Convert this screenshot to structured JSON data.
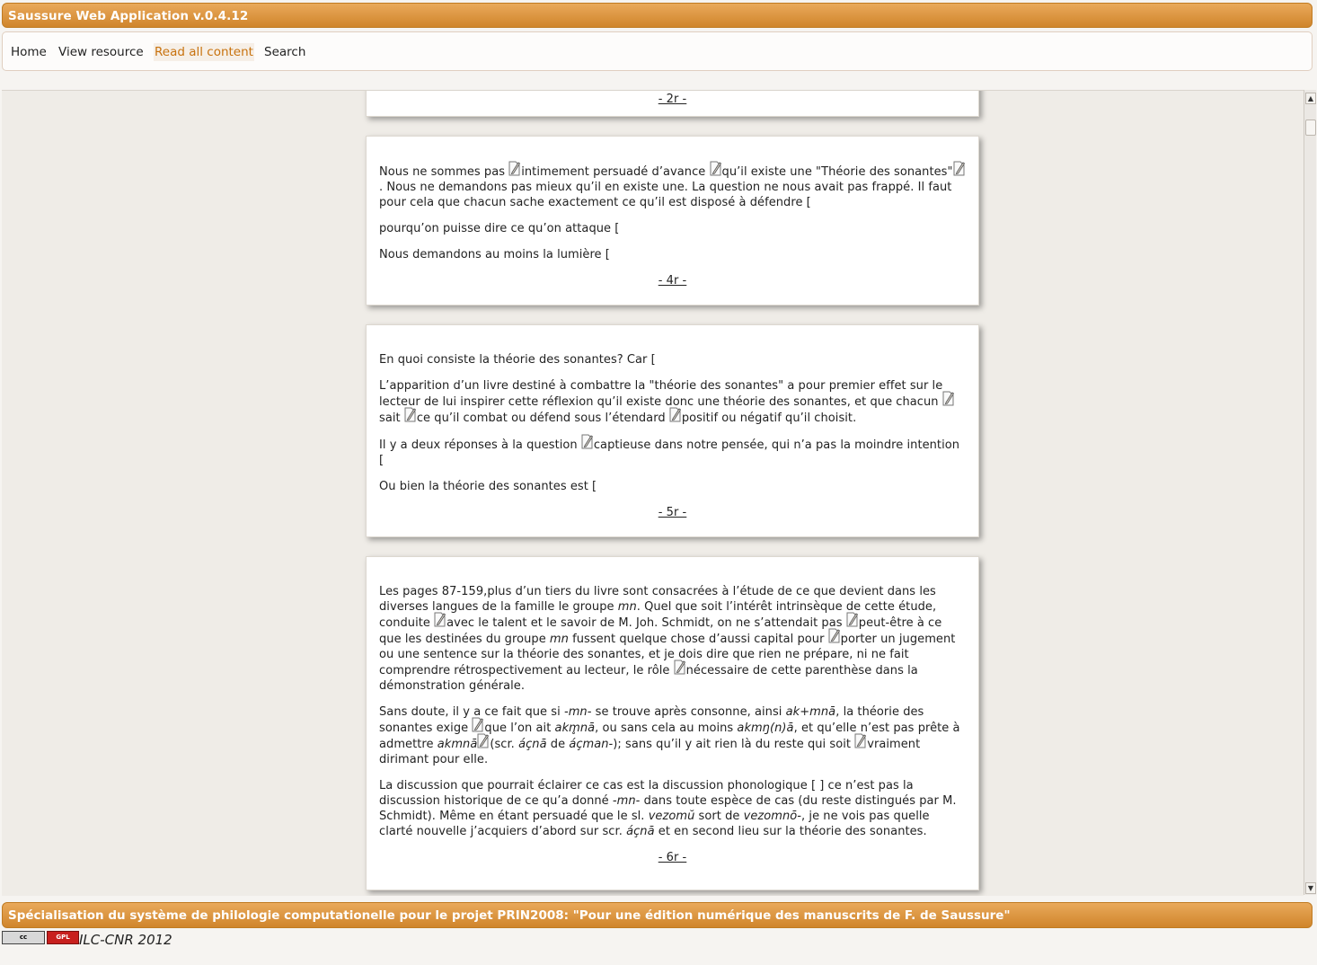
{
  "app": {
    "title": "Saussure Web Application v.0.4.12"
  },
  "nav": {
    "items": [
      {
        "label": "Home",
        "active": false
      },
      {
        "label": "View resource",
        "active": false
      },
      {
        "label": "Read all content",
        "active": true
      },
      {
        "label": "Search",
        "active": false
      }
    ]
  },
  "pages": [
    {
      "label": "- 2r -"
    },
    {
      "label": "- 4r -",
      "paragraphs": [
        [
          "Nous ne sommes pas ",
          {
            "edit": true
          },
          "intimement persuadé d’avance ",
          {
            "edit": true
          },
          "qu’il existe une \"Théorie des sonantes\"",
          {
            "edit": true
          },
          ". Nous ne demandons pas mieux qu’il en existe une. La question ne nous avait pas frappé. Il faut pour cela que chacun sache exactement ce qu’il est disposé à défendre ["
        ],
        [
          "pourqu’on puisse dire ce qu’on attaque ["
        ],
        [
          "Nous demandons au moins la lumière ["
        ]
      ]
    },
    {
      "label": "- 5r -",
      "paragraphs": [
        [
          "En quoi consiste la théorie des sonantes? Car ["
        ],
        [
          "L’apparition d’un livre destiné à combattre la \"théorie des sonantes\" a pour premier effet sur le lecteur de lui inspirer cette réflexion qu’il existe donc une théorie des sonantes, et que chacun ",
          {
            "edit": true
          },
          "sait ",
          {
            "edit": true
          },
          "ce qu’il combat ou défend sous l’étendard ",
          {
            "edit": true
          },
          "positif ou négatif qu’il choisit."
        ],
        [
          "Il y a deux réponses à la question ",
          {
            "edit": true
          },
          "captieuse dans notre pensée, qui n’a pas la moindre intention ["
        ],
        [
          "Ou bien la théorie des sonantes est ["
        ]
      ]
    },
    {
      "label": "- 6r -",
      "paragraphs": [
        [
          "Les pages 87-159,plus d’un tiers du livre sont consacrées à l’étude de ce que devient dans les diverses langues de la famille le groupe ",
          {
            "i": "mn"
          },
          ". Quel que soit l’intérêt intrinsèque de cette étude, conduite ",
          {
            "edit": true
          },
          "avec le talent et le savoir de M. Joh. Schmidt, on ne s’attendait pas ",
          {
            "edit": true
          },
          "peut-être à ce que les destinées du groupe ",
          {
            "i": "mn"
          },
          " fussent quelque chose d’aussi capital pour ",
          {
            "edit": true
          },
          "porter un jugement ou une sentence sur la théorie des sonantes, et je dois dire que rien ne prépare, ni ne fait comprendre rétrospectivement au lecteur, le rôle ",
          {
            "edit": true
          },
          "nécessaire de cette parenthèse dans la démonstration générale."
        ],
        [
          "Sans doute, il y a ce fait que si ",
          {
            "i": "-mn-"
          },
          " se trouve après consonne, ainsi ",
          {
            "i": "ak+mnā"
          },
          ", la théorie des sonantes exige ",
          {
            "edit": true
          },
          "que l’on ait ",
          {
            "i": "akm̥nā"
          },
          ", ou sans cela au moins ",
          {
            "i": "akmŋ(n)ā"
          },
          ", et qu’elle n’est pas prête à admettre ",
          {
            "i": "akmnā"
          },
          {
            "edit": true
          },
          "(scr. ",
          {
            "i": "áçnā"
          },
          " de ",
          {
            "i": "áçman-"
          },
          "); sans qu’il y ait rien là du reste qui soit ",
          {
            "edit": true
          },
          "vraiment dirimant pour elle."
        ],
        [
          "La discussion que pourrait éclairer ce cas est la discussion phonologique [ ] ce n’est pas la discussion historique de ce qu’a donné ",
          {
            "i": "-mn-"
          },
          " dans toute espèce de cas (du reste distingués par M. Schmidt). Même en étant persuadé que le sl. ",
          {
            "i": "vezomŭ"
          },
          " sort de ",
          {
            "i": "vezomnō-"
          },
          ", je ne vois pas quelle clarté nouvelle j’acquiers d’abord sur scr. ",
          {
            "i": "áçnā"
          },
          " et en second lieu sur la théorie des sonantes."
        ]
      ]
    }
  ],
  "footer": {
    "text": "Spécialisation du système de philologie computationelle pour le projet PRIN2008: \"Pour une édition numérique des manuscrits de F. de Saussure\"",
    "badge_cc": "cc",
    "badge_gpl": "GPL",
    "credit": "ILC-CNR 2012"
  },
  "colors": {
    "accent": "#d98e35",
    "active_link": "#c8720e"
  }
}
